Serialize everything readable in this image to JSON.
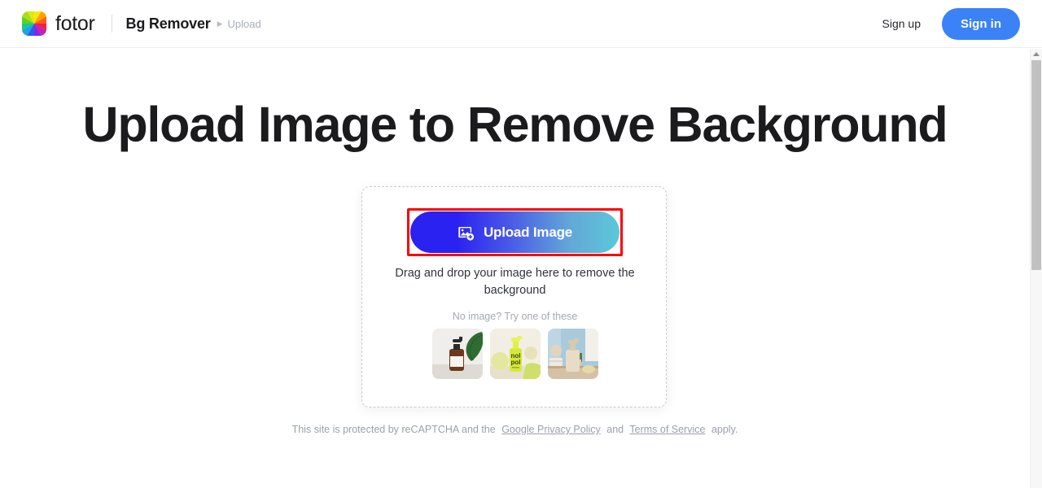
{
  "header": {
    "logo_icon": "fotor-color-wheel-logo",
    "brand": "fotor",
    "breadcrumb": {
      "app": "Bg Remover",
      "separator_icon": "chevron-right-icon",
      "current": "Upload"
    },
    "signup_label": "Sign up",
    "signin_label": "Sign in",
    "signin_color": "#3b82f6"
  },
  "main": {
    "headline": "Upload Image to Remove Background",
    "dropzone": {
      "upload_button": {
        "label": "Upload Image",
        "icon": "add-image-icon",
        "gradient_from": "#2a22f0",
        "gradient_to": "#5cc8d8",
        "highlight_color": "#fe0000"
      },
      "drag_text": "Drag and drop your image here to remove the background",
      "try_text": "No image? Try one of these",
      "samples": [
        {
          "name": "amber-pump-bottle-with-leaf"
        },
        {
          "name": "yellow-green-serum-bottle"
        },
        {
          "name": "beige-soap-dispenser"
        }
      ]
    }
  },
  "footer": {
    "text_before": "This site is protected by reCAPTCHA and the",
    "privacy_link": "Google Privacy Policy",
    "text_middle": "and",
    "terms_link": "Terms of Service",
    "text_after": "apply."
  },
  "scrollbar": {
    "up_arrow_icon": "scroll-up-arrow-icon"
  }
}
